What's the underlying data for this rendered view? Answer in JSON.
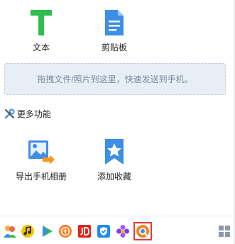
{
  "quick_actions": {
    "text_label": "文本",
    "clipboard_label": "剪贴板"
  },
  "dropzone": {
    "hint": "拖拽文件/照片到这里，快速发送到手机。"
  },
  "more_features": {
    "title": "更多功能",
    "export_album_label": "导出手机相册",
    "add_favorite_label": "添加收藏"
  },
  "colors": {
    "accent_green": "#2fbd52",
    "accent_blue": "#3d8ee6",
    "selection_red": "#e63a3a"
  },
  "bottom_bar": {
    "icons": [
      "people-icon",
      "music-icon",
      "play-icon",
      "coupon-icon",
      "jd-icon",
      "shield-icon",
      "flower-icon",
      "browser-icon",
      "grid-icon"
    ],
    "selected": "browser-icon"
  }
}
